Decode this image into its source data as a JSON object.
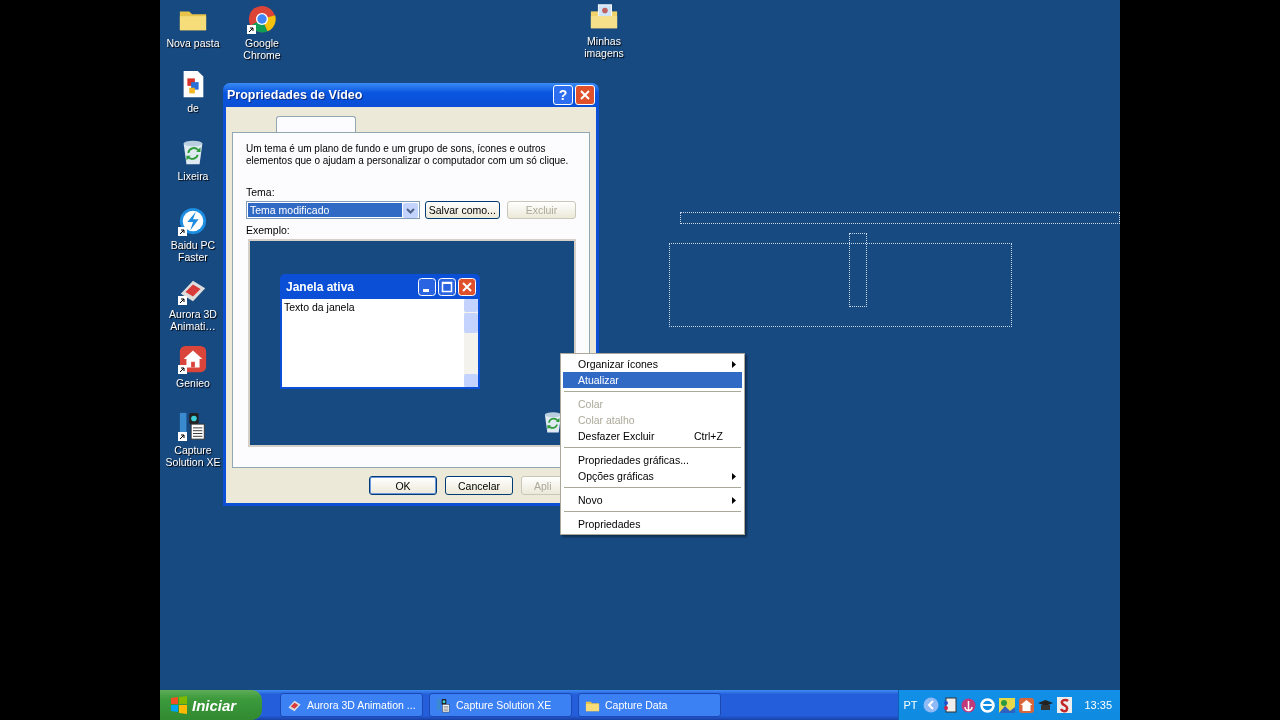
{
  "desktop_icons": [
    {
      "label": "Nova pasta",
      "kind": "folder",
      "shortcut": false
    },
    {
      "label": "Google Chrome",
      "kind": "chrome",
      "shortcut": true
    },
    {
      "label": "Minhas imagens",
      "kind": "pictures",
      "shortcut": false
    },
    {
      "label": "de",
      "kind": "document",
      "shortcut": false
    },
    {
      "label": "Lixeira",
      "kind": "recycle",
      "shortcut": false
    },
    {
      "label": "Baidu PC Faster",
      "kind": "baidu",
      "shortcut": true
    },
    {
      "label": "Aurora 3D Animati…",
      "kind": "aurora",
      "shortcut": true
    },
    {
      "label": "Genieo",
      "kind": "genieo",
      "shortcut": true
    },
    {
      "label": "Capture Solution XE",
      "kind": "capture",
      "shortcut": true
    }
  ],
  "dialog": {
    "title": "Propriedades de Vídeo",
    "help_label": "?",
    "description": "Um tema é um plano de fundo e um grupo de sons, ícones e outros elementos que o ajudam a personalizar o computador com um só clique.",
    "theme_label": "Tema:",
    "theme_value": "Tema modificado",
    "theme_buttons": [
      {
        "label": "Salvar como...",
        "disabled": false
      },
      {
        "label": "Excluir",
        "disabled": true
      }
    ],
    "example_label": "Exemplo:",
    "preview": {
      "window_title": "Janela ativa",
      "window_text": "Texto da janela"
    },
    "buttons": [
      {
        "label": "OK",
        "disabled": false,
        "default": true
      },
      {
        "label": "Cancelar",
        "disabled": false,
        "default": false
      },
      {
        "label": "Apli",
        "disabled": true,
        "default": false
      }
    ]
  },
  "context_menu": {
    "items": [
      {
        "kind": "item",
        "label": "Organizar ícones",
        "submenu": true,
        "disabled": false,
        "selected": false
      },
      {
        "kind": "item",
        "label": "Atualizar",
        "submenu": false,
        "disabled": false,
        "selected": true
      },
      {
        "kind": "separator"
      },
      {
        "kind": "item",
        "label": "Colar",
        "submenu": false,
        "disabled": true,
        "selected": false
      },
      {
        "kind": "item",
        "label": "Colar atalho",
        "submenu": false,
        "disabled": true,
        "selected": false
      },
      {
        "kind": "item",
        "label": "Desfazer Excluir",
        "shortcut": "Ctrl+Z",
        "submenu": false,
        "disabled": false,
        "selected": false
      },
      {
        "kind": "separator"
      },
      {
        "kind": "item",
        "label": "Propriedades gráficas...",
        "submenu": false,
        "disabled": false,
        "selected": false
      },
      {
        "kind": "item",
        "label": "Opções gráficas",
        "submenu": true,
        "disabled": false,
        "selected": false
      },
      {
        "kind": "separator"
      },
      {
        "kind": "item",
        "label": "Novo",
        "submenu": true,
        "disabled": false,
        "selected": false
      },
      {
        "kind": "separator"
      },
      {
        "kind": "item",
        "label": "Propriedades",
        "submenu": false,
        "disabled": false,
        "selected": false
      }
    ]
  },
  "taskbar": {
    "start_label": "Iniciar",
    "tasks": [
      {
        "label": "Aurora 3D Animation ...",
        "kind": "aurora"
      },
      {
        "label": "Capture Solution XE",
        "kind": "capture"
      },
      {
        "label": "Capture Data",
        "kind": "folder"
      }
    ],
    "language": "PT",
    "clock": "13:35"
  }
}
